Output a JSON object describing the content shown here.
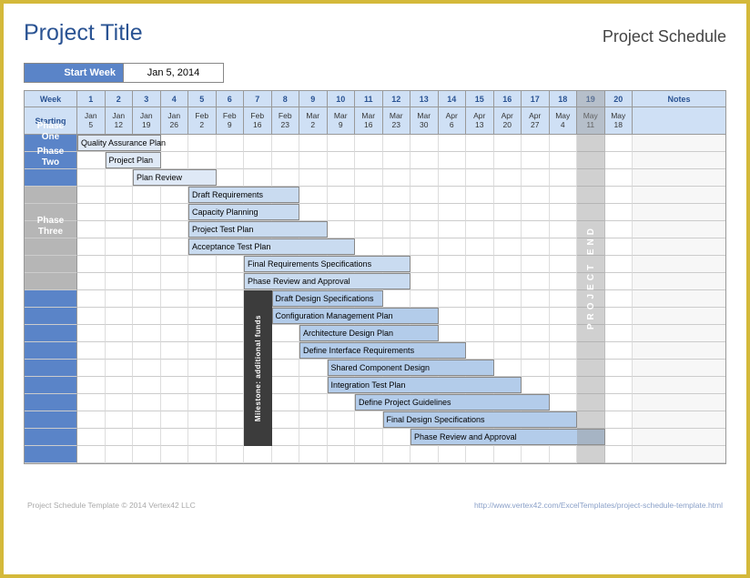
{
  "header": {
    "title": "Project Title",
    "subtitle": "Project Schedule"
  },
  "start_week": {
    "label": "Start Week",
    "value": "Jan 5, 2014"
  },
  "columns": {
    "week_label": "Week",
    "starting_label": "Starting",
    "notes_label": "Notes"
  },
  "weeks": [
    {
      "num": "1",
      "m": "Jan",
      "d": "5"
    },
    {
      "num": "2",
      "m": "Jan",
      "d": "12"
    },
    {
      "num": "3",
      "m": "Jan",
      "d": "19"
    },
    {
      "num": "4",
      "m": "Jan",
      "d": "26"
    },
    {
      "num": "5",
      "m": "Feb",
      "d": "2"
    },
    {
      "num": "6",
      "m": "Feb",
      "d": "9"
    },
    {
      "num": "7",
      "m": "Feb",
      "d": "16"
    },
    {
      "num": "8",
      "m": "Feb",
      "d": "23"
    },
    {
      "num": "9",
      "m": "Mar",
      "d": "2"
    },
    {
      "num": "10",
      "m": "Mar",
      "d": "9"
    },
    {
      "num": "11",
      "m": "Mar",
      "d": "16"
    },
    {
      "num": "12",
      "m": "Mar",
      "d": "23"
    },
    {
      "num": "13",
      "m": "Mar",
      "d": "30"
    },
    {
      "num": "14",
      "m": "Apr",
      "d": "6"
    },
    {
      "num": "15",
      "m": "Apr",
      "d": "13"
    },
    {
      "num": "16",
      "m": "Apr",
      "d": "20"
    },
    {
      "num": "17",
      "m": "Apr",
      "d": "27"
    },
    {
      "num": "18",
      "m": "May",
      "d": "4"
    },
    {
      "num": "19",
      "m": "May",
      "d": "11"
    },
    {
      "num": "20",
      "m": "May",
      "d": "18"
    }
  ],
  "phases": [
    {
      "name": "Phase One",
      "row_start": 0,
      "rows": 3,
      "type": "phase"
    },
    {
      "name": "Phase Two",
      "row_start": 3,
      "rows": 6,
      "type": "gap"
    },
    {
      "name": "Phase Three",
      "row_start": 9,
      "rows": 10,
      "type": "phase"
    }
  ],
  "chart_data": {
    "type": "bar",
    "title": "Project Schedule",
    "xlabel": "Week",
    "ylabel": "",
    "x_range": [
      1,
      20
    ],
    "series": [
      {
        "name": "Quality Assurance Plan",
        "start": 1,
        "span": 3,
        "color": "#dfe9f6"
      },
      {
        "name": "Project Plan",
        "start": 2,
        "span": 2,
        "color": "#dfe9f6"
      },
      {
        "name": "Plan Review",
        "start": 3,
        "span": 3,
        "color": "#dfe9f6"
      },
      {
        "name": "Draft Requirements",
        "start": 5,
        "span": 4,
        "color": "#c9dbf0"
      },
      {
        "name": "Capacity Planning",
        "start": 5,
        "span": 4,
        "color": "#c9dbf0"
      },
      {
        "name": "Project Test Plan",
        "start": 5,
        "span": 5,
        "color": "#c9dbf0"
      },
      {
        "name": "Acceptance Test Plan",
        "start": 5,
        "span": 6,
        "color": "#c9dbf0"
      },
      {
        "name": "Final Requirements Specifications",
        "start": 7,
        "span": 6,
        "color": "#c9dbf0"
      },
      {
        "name": "Phase Review and Approval",
        "start": 7,
        "span": 6,
        "color": "#c9dbf0"
      },
      {
        "name": "Draft Design Specifications",
        "start": 8,
        "span": 4,
        "color": "#b3ccea"
      },
      {
        "name": "Configuration Management Plan",
        "start": 8,
        "span": 6,
        "color": "#b3ccea"
      },
      {
        "name": "Architecture Design Plan",
        "start": 9,
        "span": 5,
        "color": "#b3ccea"
      },
      {
        "name": "Define Interface Requirements",
        "start": 9,
        "span": 6,
        "color": "#b3ccea"
      },
      {
        "name": "Shared Component Design",
        "start": 10,
        "span": 6,
        "color": "#b3ccea"
      },
      {
        "name": "Integration Test Plan",
        "start": 10,
        "span": 7,
        "color": "#b3ccea"
      },
      {
        "name": "Define Project Guidelines",
        "start": 11,
        "span": 7,
        "color": "#b3ccea"
      },
      {
        "name": "Final Design Specifications",
        "start": 12,
        "span": 7,
        "color": "#b3ccea"
      },
      {
        "name": "Phase Review and Approval",
        "start": 13,
        "span": 7,
        "color": "#b3ccea"
      }
    ],
    "milestone": {
      "label": "Milestone: additional funds",
      "week": 7
    },
    "project_end": {
      "label": "PROJECT END",
      "week": 19
    }
  },
  "footer": {
    "left": "Project Schedule Template © 2014 Vertex42 LLC",
    "right": "http://www.vertex42.com/ExcelTemplates/project-schedule-template.html"
  }
}
